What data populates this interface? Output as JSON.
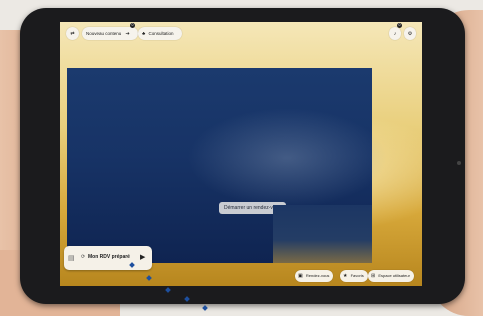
{
  "header": {
    "nouveau_contenu": "Nouveau contenu",
    "nouveau_badge": "0",
    "consultation": "Consultation",
    "notif_badge": "0"
  },
  "video": {
    "cta": "Démarrer un rendez-vous"
  },
  "rdv_card": {
    "label": "Mon RDV préparé"
  },
  "bottom_nav": {
    "rendez_vous": "Rendez-vous",
    "favoris": "Favoris",
    "espace_utilisateur": "Espace utilisateur"
  },
  "colors": {
    "accent_blue": "#1d4f9e",
    "gold": "#d7a83a"
  }
}
